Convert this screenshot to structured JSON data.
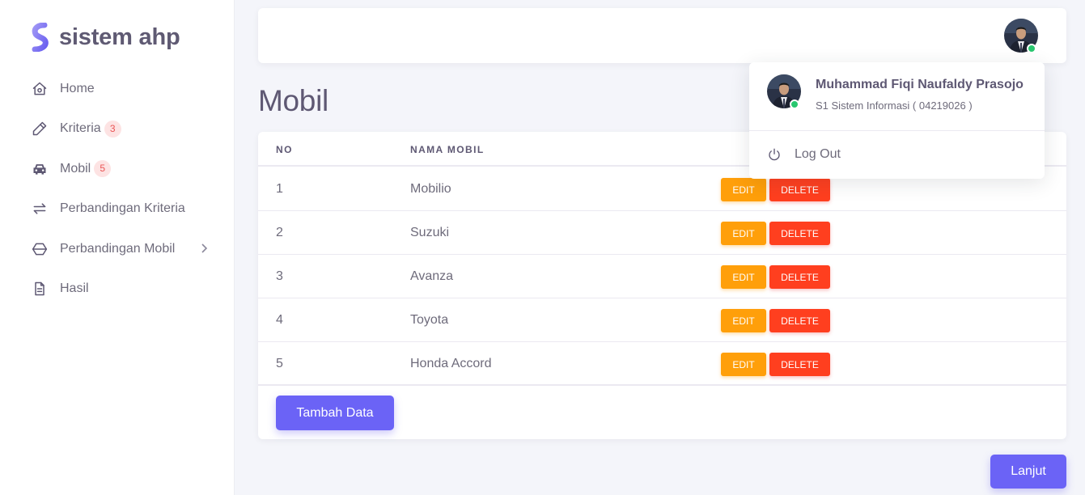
{
  "brand": {
    "name": "sistem ahp",
    "color": "#7367f0"
  },
  "sidebar": {
    "items": [
      {
        "label": "Home",
        "icon": "home-icon"
      },
      {
        "label": "Kriteria",
        "icon": "edit-pencil-icon",
        "badge": "3"
      },
      {
        "label": "Mobil",
        "icon": "car-icon",
        "badge": "5"
      },
      {
        "label": "Perbandingan Kriteria",
        "icon": "swap-arrows-icon"
      },
      {
        "label": "Perbandingan Mobil",
        "icon": "hexagon-icon",
        "has_submenu": true
      },
      {
        "label": "Hasil",
        "icon": "file-text-icon"
      }
    ]
  },
  "page": {
    "title": "Mobil"
  },
  "table": {
    "columns": [
      "NO",
      "NAMA MOBIL"
    ],
    "rows": [
      {
        "no": "1",
        "name": "Mobilio"
      },
      {
        "no": "2",
        "name": "Suzuki"
      },
      {
        "no": "3",
        "name": "Avanza"
      },
      {
        "no": "4",
        "name": "Toyota"
      },
      {
        "no": "5",
        "name": "Honda Accord"
      }
    ],
    "edit_label": "EDIT",
    "delete_label": "DELETE",
    "add_label": "Tambah Data"
  },
  "next_label": "Lanjut",
  "user": {
    "name": "Muhammad Fiqi Naufaldy Prasojo",
    "subtitle": "S1 Sistem Informasi ( 04219026 )",
    "status": "online",
    "logout_label": "Log Out"
  },
  "colors": {
    "primary": "#7367f0",
    "warning": "#ff9f0a",
    "danger": "#ff3f1f",
    "success": "#28c76f"
  }
}
